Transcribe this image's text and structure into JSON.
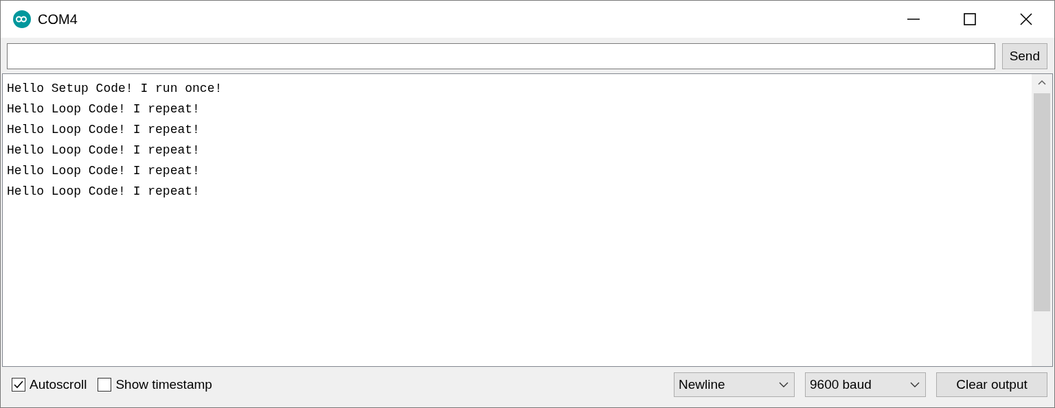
{
  "window": {
    "title": "COM4"
  },
  "send_button": "Send",
  "output": {
    "lines": [
      "Hello Setup Code! I run once!",
      "Hello Loop Code! I repeat!",
      "Hello Loop Code! I repeat!",
      "Hello Loop Code! I repeat!",
      "Hello Loop Code! I repeat!",
      "Hello Loop Code! I repeat!"
    ]
  },
  "footer": {
    "checkboxes": [
      {
        "label": "Autoscroll",
        "checked": true
      },
      {
        "label": "Show timestamp",
        "checked": false
      }
    ],
    "dropdowns": [
      "Newline",
      "9600 baud"
    ],
    "clear_button": "Clear output"
  }
}
